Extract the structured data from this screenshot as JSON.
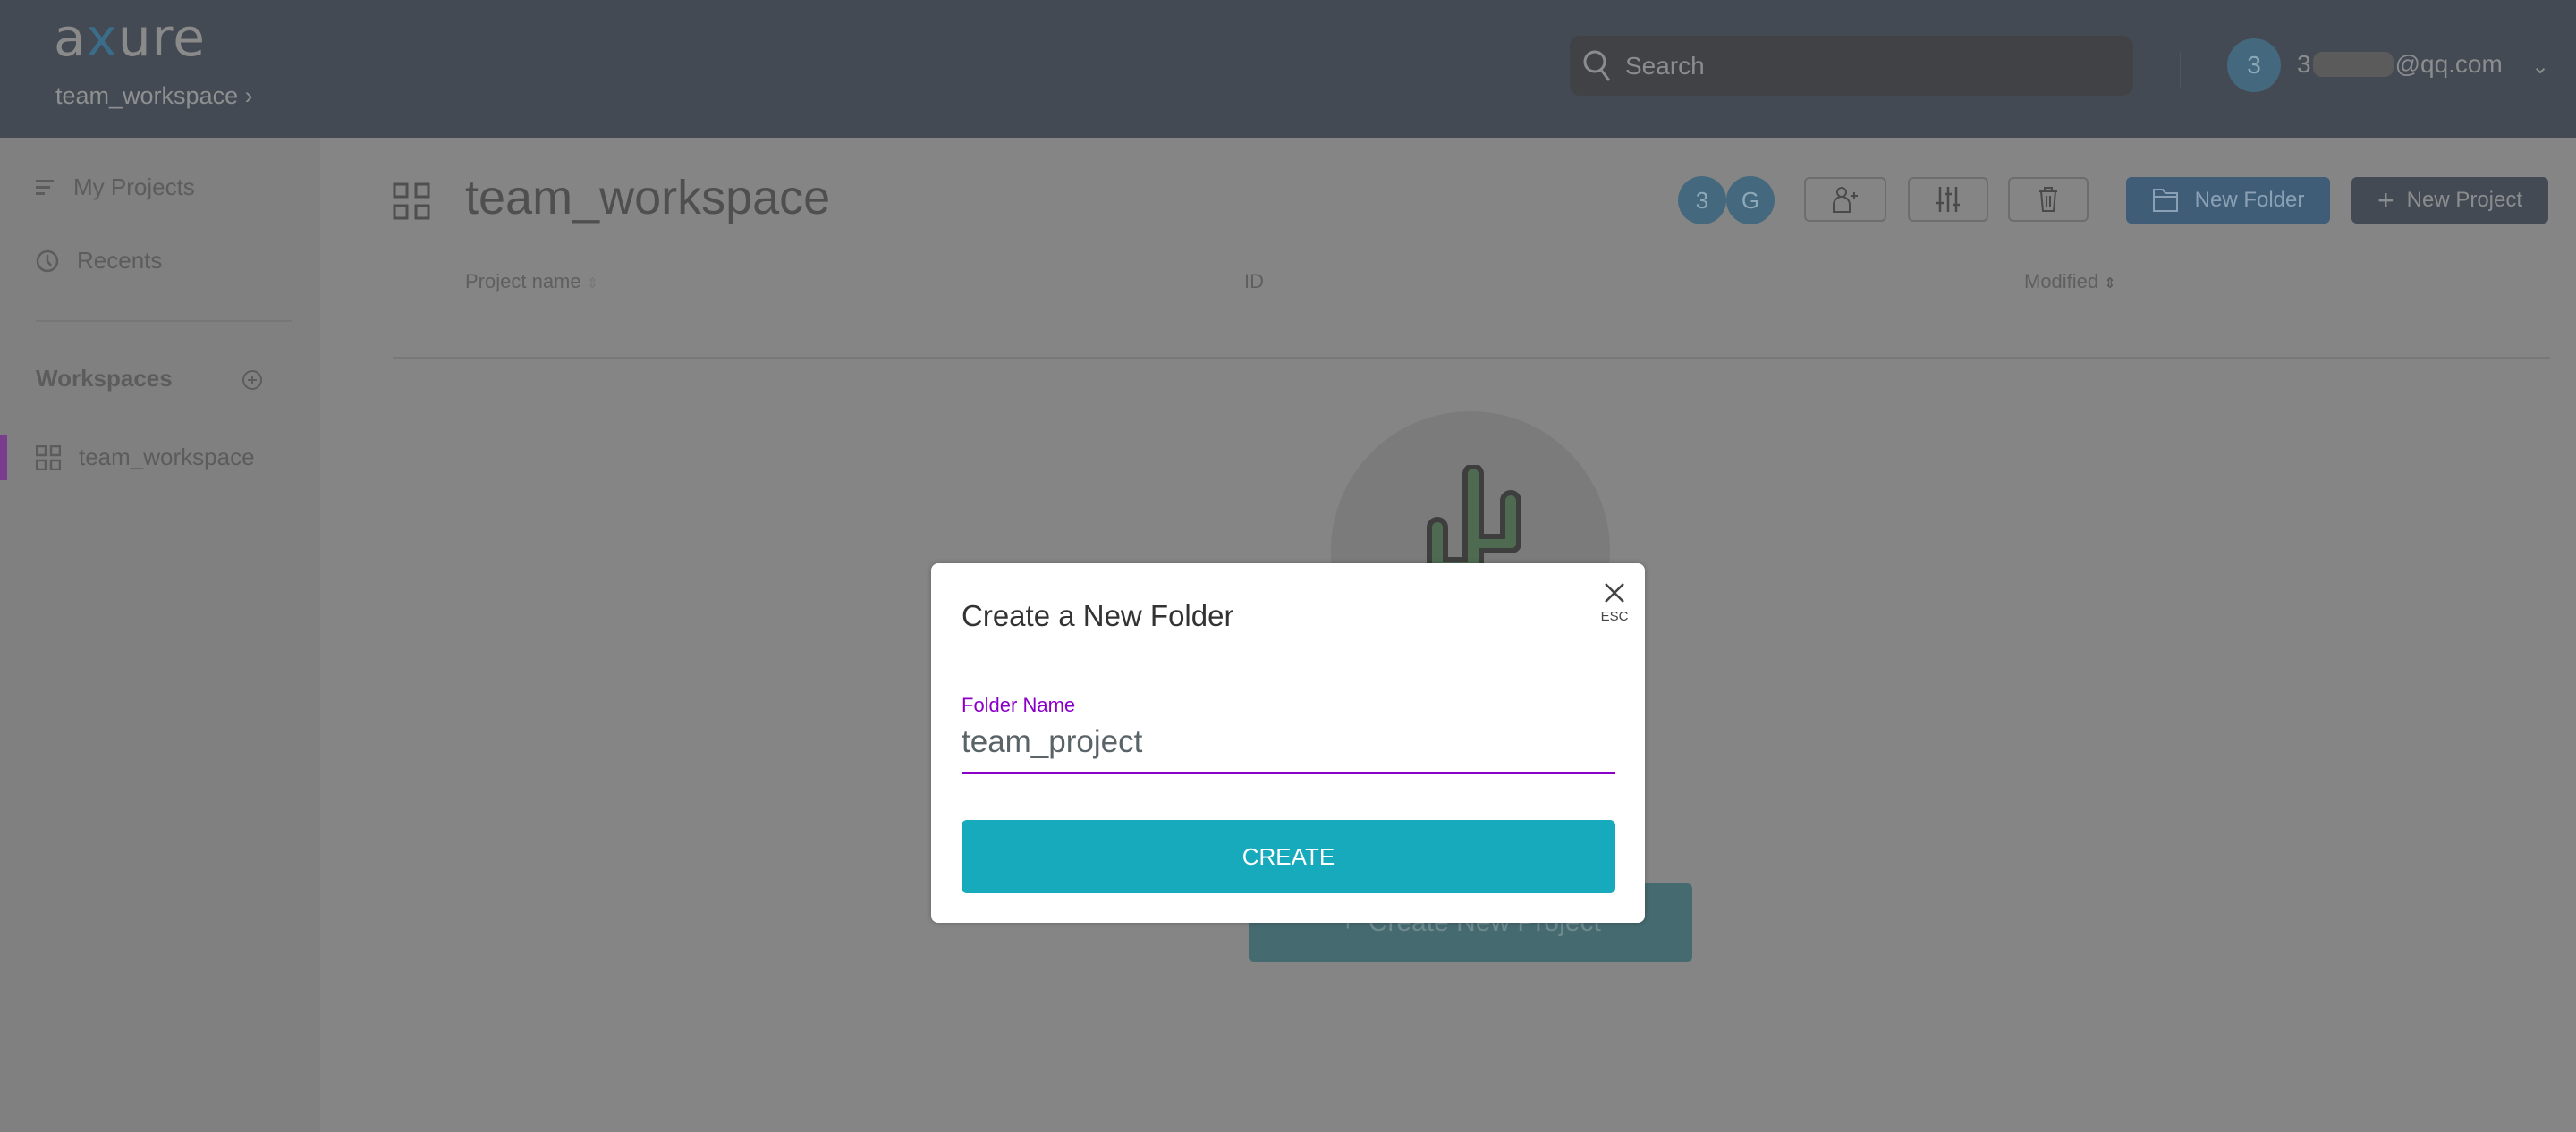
{
  "header": {
    "logo": "axure",
    "breadcrumb": "team_workspace",
    "search_placeholder": "Search",
    "user_initial": "3",
    "email_prefix": "3",
    "email_suffix": "@qq.com"
  },
  "sidebar": {
    "items": [
      {
        "label": "My Projects",
        "icon": "list-icon"
      },
      {
        "label": "Recents",
        "icon": "clock-icon"
      }
    ],
    "workspaces_label": "Workspaces",
    "workspaces": [
      {
        "label": "team_workspace",
        "active": true
      }
    ]
  },
  "main": {
    "title": "team_workspace",
    "members": [
      "3",
      "G"
    ],
    "new_folder": "New Folder",
    "new_project": "New Project",
    "columns": [
      "Project name",
      "ID",
      "Modified"
    ],
    "empty_button": "Create New Project"
  },
  "modal": {
    "title": "Create a New Folder",
    "close_hint": "ESC",
    "field_label": "Folder Name",
    "field_value": "team_project",
    "submit": "CREATE"
  },
  "colors": {
    "accent": "#17a9bc",
    "focus": "#8a00c8",
    "active_bar": "#7a3d8e"
  }
}
